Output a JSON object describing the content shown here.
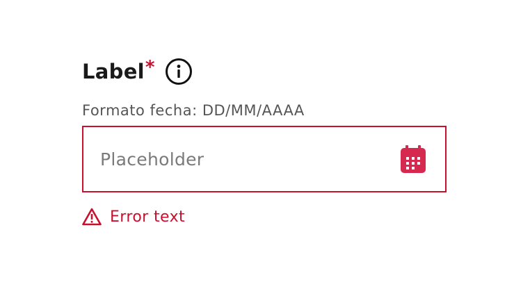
{
  "field": {
    "label": "Label",
    "required_marker": "*",
    "hint": "Formato fecha: DD/MM/AAAA",
    "input_value": "",
    "input_placeholder": "Placeholder",
    "error_text": "Error text",
    "icons": {
      "info": "info-icon",
      "calendar": "calendar-icon",
      "warning": "warning-icon"
    }
  },
  "colors": {
    "error": "#c8102e",
    "calendar_accent": "#d6294f",
    "label": "#1a1a1a",
    "hint": "#555555",
    "placeholder": "#7a7a7a"
  }
}
